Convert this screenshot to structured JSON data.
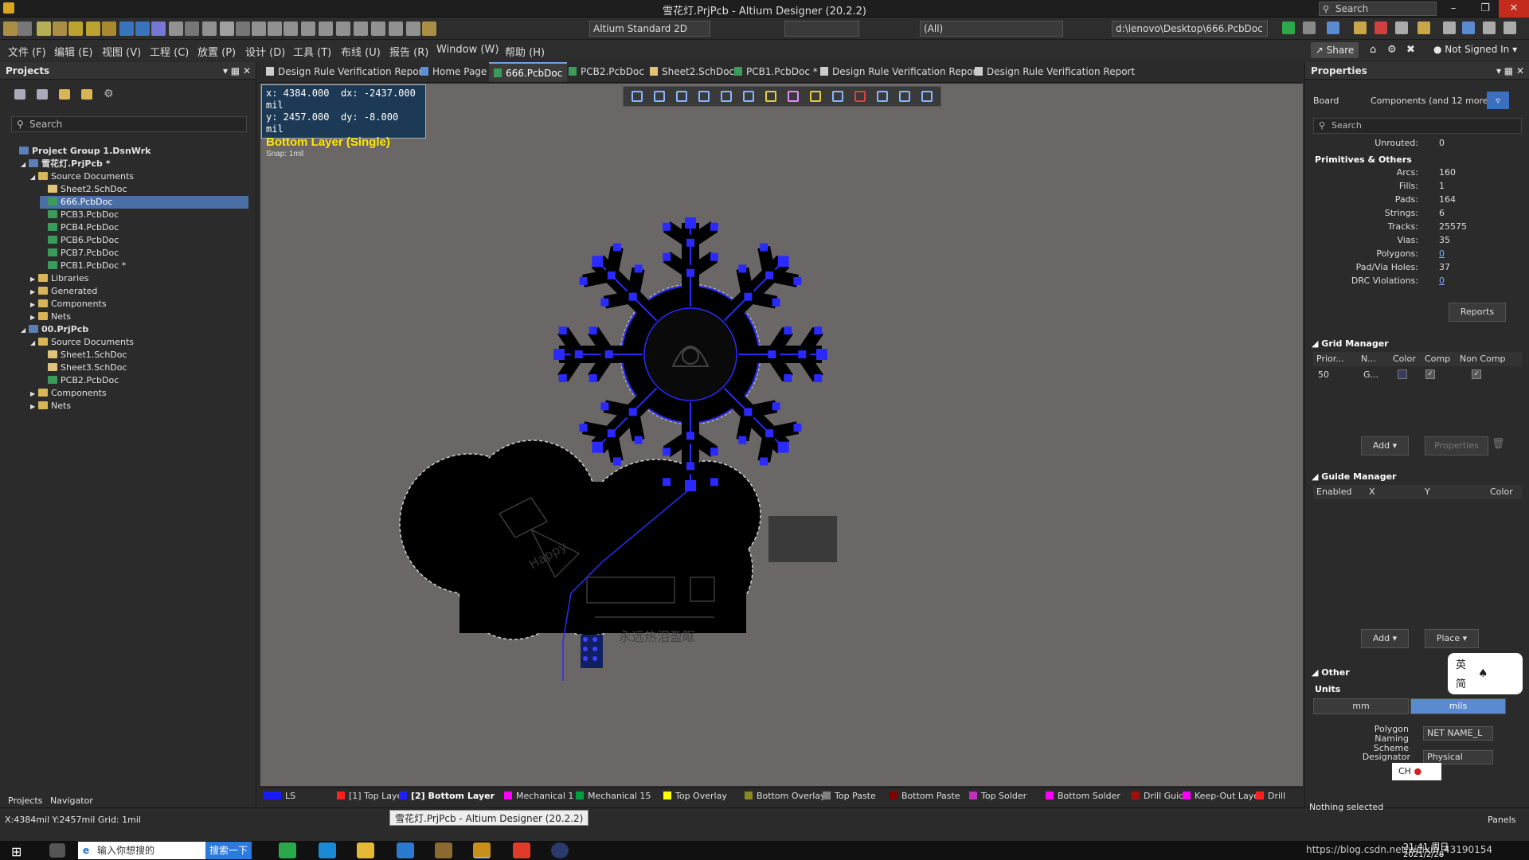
{
  "window": {
    "title": "雪花灯.PrjPcb - Altium Designer (20.2.2)",
    "search_placeholder": "Search"
  },
  "toolbar": {
    "view_mode": "Altium Standard 2D",
    "filter_all": "(All)",
    "path": "d:\\lenovo\\Desktop\\666.PcbDoc",
    "share": "Share",
    "not_signed_in": "Not Signed In"
  },
  "menu": [
    "文件 (F)",
    "编辑 (E)",
    "视图 (V)",
    "工程 (C)",
    "放置 (P)",
    "设计 (D)",
    "工具 (T)",
    "布线 (U)",
    "报告 (R)",
    "Window (W)",
    "帮助 (H)"
  ],
  "projects_panel": {
    "title": "Projects",
    "search_placeholder": "Search",
    "tree": [
      {
        "label": "Project Group 1.DsnWrk",
        "kind": "prj",
        "level": 0
      },
      {
        "label": "雪花灯.PrjPcb *",
        "kind": "prj",
        "level": 1
      },
      {
        "label": "Source Documents",
        "kind": "folder",
        "level": 2
      },
      {
        "label": "Sheet2.SchDoc",
        "kind": "sch",
        "level": 3
      },
      {
        "label": "666.PcbDoc",
        "kind": "pcb",
        "level": 3,
        "selected": true
      },
      {
        "label": "PCB3.PcbDoc",
        "kind": "pcb",
        "level": 3
      },
      {
        "label": "PCB4.PcbDoc",
        "kind": "pcb",
        "level": 3
      },
      {
        "label": "PCB6.PcbDoc",
        "kind": "pcb",
        "level": 3
      },
      {
        "label": "PCB7.PcbDoc",
        "kind": "pcb",
        "level": 3
      },
      {
        "label": "PCB1.PcbDoc *",
        "kind": "pcb",
        "level": 3
      },
      {
        "label": "Libraries",
        "kind": "folder",
        "level": 2
      },
      {
        "label": "Generated",
        "kind": "folder",
        "level": 2
      },
      {
        "label": "Components",
        "kind": "folder",
        "level": 2
      },
      {
        "label": "Nets",
        "kind": "folder",
        "level": 2
      },
      {
        "label": "00.PrjPcb",
        "kind": "prj",
        "level": 1
      },
      {
        "label": "Source Documents",
        "kind": "folder",
        "level": 2
      },
      {
        "label": "Sheet1.SchDoc",
        "kind": "sch",
        "level": 3
      },
      {
        "label": "Sheet3.SchDoc",
        "kind": "sch",
        "level": 3
      },
      {
        "label": "PCB2.PcbDoc",
        "kind": "pcb",
        "level": 3
      },
      {
        "label": "Components",
        "kind": "folder",
        "level": 2
      },
      {
        "label": "Nets",
        "kind": "folder",
        "level": 2
      }
    ],
    "bottom_tabs": [
      "Projects",
      "Navigator"
    ]
  },
  "doc_tabs": [
    {
      "label": "Design Rule Verification Report",
      "active": false
    },
    {
      "label": "Home Page",
      "active": false
    },
    {
      "label": "666.PcbDoc",
      "active": true
    },
    {
      "label": "PCB2.PcbDoc",
      "active": false
    },
    {
      "label": "Sheet2.SchDoc",
      "active": false
    },
    {
      "label": "PCB1.PcbDoc *",
      "active": false
    },
    {
      "label": "Design Rule Verification Report",
      "active": false
    },
    {
      "label": "Design Rule Verification Report",
      "active": false
    }
  ],
  "hud": {
    "x": "x:  4384.000",
    "dx": "dx:  -2437.000 mil",
    "y": "y:  2457.000",
    "dy": "dy:    -8.000   mil",
    "layer": "Bottom Layer (Single)",
    "snap": "Snap: 1mil"
  },
  "board_text": {
    "chinese_line": "永远热泪盈眶",
    "happy": "Happy"
  },
  "layers": [
    {
      "label": "LS",
      "color": "#1a1aff"
    },
    {
      "label": "[1] Top Layer",
      "color": "#ff2020"
    },
    {
      "label": "[2] Bottom Layer",
      "color": "#2020ff"
    },
    {
      "label": "Mechanical 1",
      "color": "#ff00ff"
    },
    {
      "label": "Mechanical 15",
      "color": "#00a040"
    },
    {
      "label": "Top Overlay",
      "color": "#ffff00"
    },
    {
      "label": "Bottom Overlay",
      "color": "#8a8a20"
    },
    {
      "label": "Top Paste",
      "color": "#808080"
    },
    {
      "label": "Bottom Paste",
      "color": "#800000"
    },
    {
      "label": "Top Solder",
      "color": "#c030c0"
    },
    {
      "label": "Bottom Solder",
      "color": "#ff00ff"
    },
    {
      "label": "Drill Guide",
      "color": "#a01010"
    },
    {
      "label": "Keep-Out Layer",
      "color": "#ff00ff"
    },
    {
      "label": "Drill",
      "color": "#ff2020"
    }
  ],
  "status": {
    "coords": "X:4384mil Y:2457mil   Grid: 1mil",
    "tooltip": "雪花灯.PrjPcb - Altium Designer (20.2.2)",
    "nothing_selected": "Nothing selected",
    "panels": "Panels"
  },
  "properties": {
    "title": "Properties",
    "board_label": "Board",
    "board_value": "Components (and 12 more)",
    "search_placeholder": "Search",
    "unrouted_label": "Unrouted:",
    "unrouted_value": "0",
    "section_primitives": "Primitives & Others",
    "primitives": [
      {
        "label": "Arcs:",
        "value": "160"
      },
      {
        "label": "Fills:",
        "value": "1"
      },
      {
        "label": "Pads:",
        "value": "164"
      },
      {
        "label": "Strings:",
        "value": "6"
      },
      {
        "label": "Tracks:",
        "value": "25575"
      },
      {
        "label": "Vias:",
        "value": "35"
      },
      {
        "label": "Polygons:",
        "value": "0"
      },
      {
        "label": "Pad/Via Holes:",
        "value": "37"
      },
      {
        "label": "DRC Violations:",
        "value": "0"
      }
    ],
    "reports_btn": "Reports",
    "grid_manager": "Grid Manager",
    "grid_cols": [
      "Prior...",
      "N...",
      "Color",
      "Comp",
      "Non Comp"
    ],
    "grid_row": {
      "priority": "50",
      "name": "G..."
    },
    "add_btn": "Add",
    "properties_btn": "Properties",
    "guide_manager": "Guide Manager",
    "guide_cols": [
      "Enabled",
      "X",
      "Y",
      "Color"
    ],
    "place_btn": "Place",
    "other": "Other",
    "units": "Units",
    "unit_mm": "mm",
    "unit_mils": "mils",
    "polygon_naming": "Polygon Naming Scheme",
    "polygon_naming_value": "NET NAME_L",
    "designator": "Designator",
    "designator_value": "Physical"
  },
  "taskbar": {
    "search_placeholder": "输入你想搜的",
    "search_btn": "搜索一下",
    "time": "21:41 周日",
    "date": "2021/2/28",
    "url_overlay": "https://blog.csdn.net/weixin_43190154",
    "ime": "CH",
    "ime_en": "英",
    "ime_simp": "简"
  }
}
